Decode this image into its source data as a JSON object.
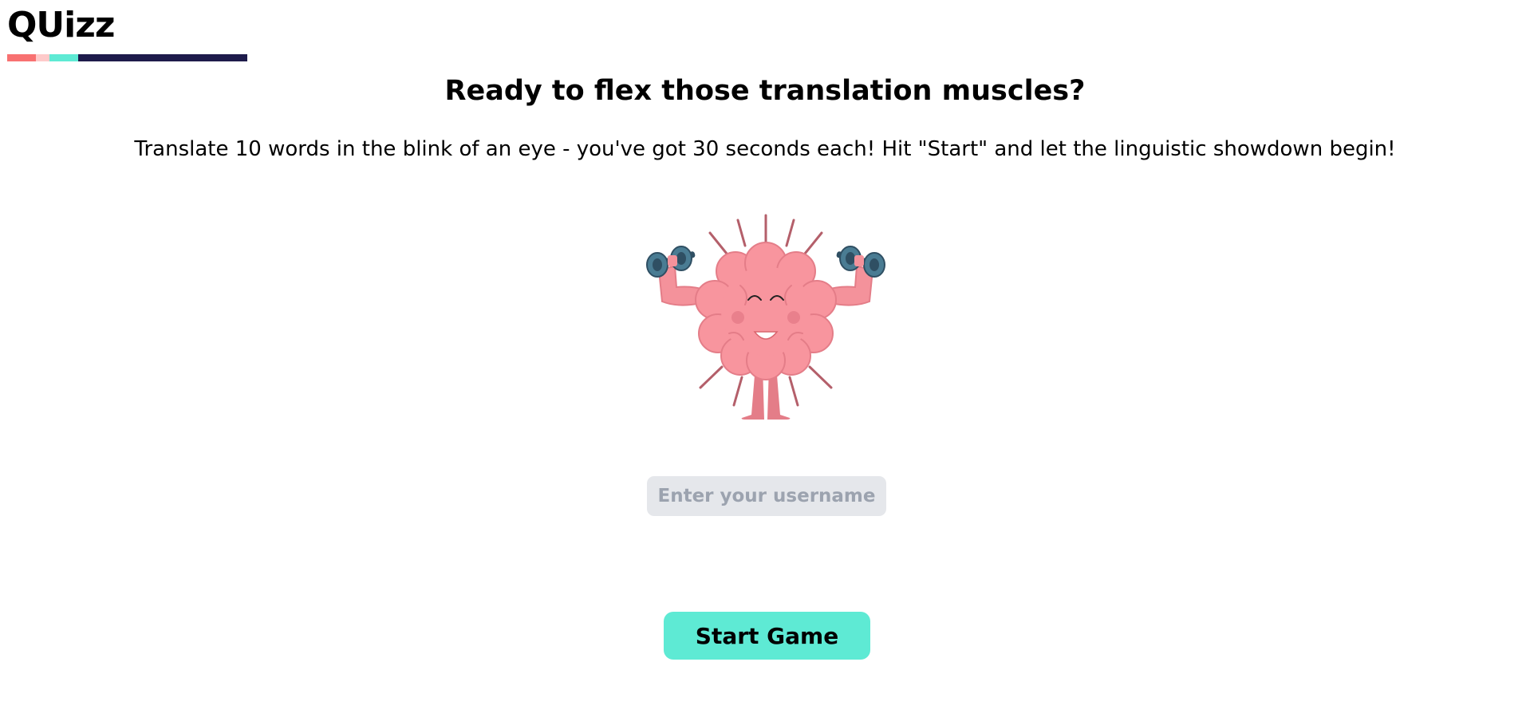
{
  "app": {
    "title": "QUizz",
    "brand_colors": [
      "#f87171",
      "#fecaca",
      "#5eead4",
      "#1e1b4b"
    ]
  },
  "main": {
    "headline": "Ready to flex those translation muscles?",
    "subtitle": "Translate 10 words in the blink of an eye - you've got 30 seconds each! Hit \"Start\" and let the linguistic showdown begin!",
    "illustration": "brain-lifting-dumbbells-icon"
  },
  "form": {
    "username_placeholder": "Enter your username",
    "username_value": "",
    "start_label": "Start Game",
    "accent_color": "#5eead4"
  }
}
